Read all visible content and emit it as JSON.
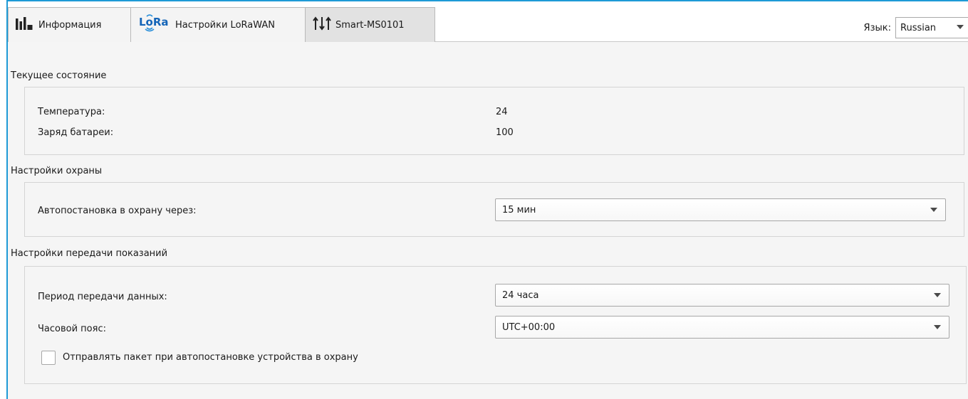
{
  "tabs": [
    {
      "label": "Информация",
      "icon": "bar-chart-icon",
      "active": false
    },
    {
      "label": "Настройки LoRaWAN",
      "icon": "lora-logo-icon",
      "logo_text": "LoRa",
      "active": false
    },
    {
      "label": "Smart-MS0101",
      "icon": "sliders-arrows-icon",
      "active": true
    }
  ],
  "language": {
    "label": "Язык:",
    "value": "Russian"
  },
  "status_section": {
    "title": "Текущее состояние",
    "rows": [
      {
        "label": "Температура:",
        "value": "24"
      },
      {
        "label": "Заряд батареи:",
        "value": "100"
      }
    ]
  },
  "security_section": {
    "title": "Настройки охраны",
    "auto_arm": {
      "label": "Автопостановка в охрану через:",
      "value": "15 мин"
    }
  },
  "transmit_section": {
    "title": "Настройки передачи показаний",
    "period": {
      "label": "Период передачи данных:",
      "value": "24 часа"
    },
    "timezone": {
      "label": "Часовой пояс:",
      "value": "UTC+00:00"
    },
    "send_packet": {
      "label": "Отправлять пакет при автопостановке устройства в охрану",
      "checked": false
    }
  },
  "colors": {
    "accent_border": "#1e9ad6",
    "lora_blue": "#1565b8",
    "lora_wave": "#2a8fd9"
  }
}
